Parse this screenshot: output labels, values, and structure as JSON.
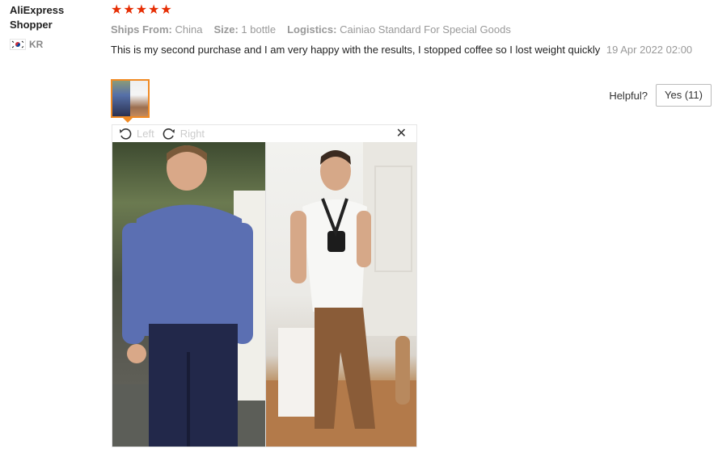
{
  "reviewer": {
    "name_line1": "AliExpress",
    "name_line2": "Shopper",
    "country_code": "KR"
  },
  "rating": {
    "stars": 5,
    "star_color": "#e62e04"
  },
  "attributes": [
    {
      "label": "Ships From:",
      "value": "China"
    },
    {
      "label": "Size:",
      "value": "1 bottle"
    },
    {
      "label": "Logistics:",
      "value": "Cainiao Standard For Special Goods"
    }
  ],
  "review": {
    "text": "This is my second purchase and I am very happy with the results, I stopped coffee so I lost weight quickly",
    "date": "19 Apr 2022 02:00"
  },
  "helpful": {
    "label": "Helpful?",
    "yes_label": "Yes (11)"
  },
  "viewer": {
    "rotate_left_label": "Left",
    "rotate_right_label": "Right",
    "close_icon": "close-icon"
  },
  "colors": {
    "thumb_border": "#f08a24",
    "muted_text": "#999999"
  }
}
